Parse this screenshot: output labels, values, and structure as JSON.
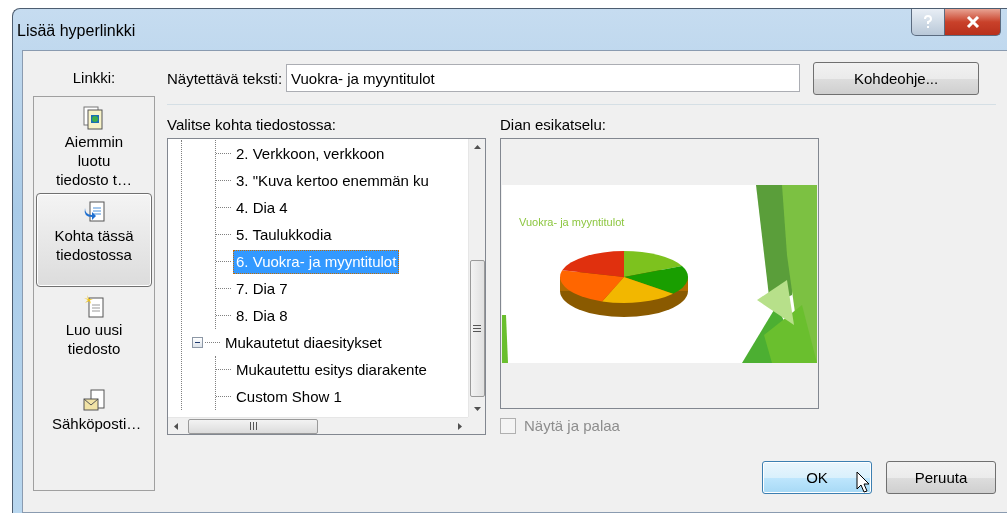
{
  "window": {
    "title": "Lisää hyperlinkki"
  },
  "link_to": {
    "label": "Linkki:",
    "items": [
      {
        "label": "Aiemmin luotu tiedosto t…",
        "selected": false
      },
      {
        "label": "Kohta tässä tiedostossa",
        "selected": true
      },
      {
        "label": "Luo uusi tiedosto",
        "selected": false
      },
      {
        "label": "Sähköposti…",
        "selected": false
      }
    ]
  },
  "display_text": {
    "label": "Näytettävä teksti:",
    "value": "Vuokra- ja myyntitulot"
  },
  "target_button": "Kohdeohje...",
  "place_tree": {
    "label": "Valitse kohta tiedostossa:",
    "items": [
      {
        "children": [
          {
            "label": "2. Verkkoon, verkkoon",
            "selected": false
          },
          {
            "label": "3. \"Kuva kertoo enemmän ku",
            "selected": false
          },
          {
            "label": "4. Dia 4",
            "selected": false
          },
          {
            "label": "5. Taulukkodia",
            "selected": false
          },
          {
            "label": "6. Vuokra- ja myyntitulot",
            "selected": true
          },
          {
            "label": "7. Dia 7",
            "selected": false
          },
          {
            "label": "8. Dia 8",
            "selected": false
          }
        ]
      },
      {
        "label": "Mukautetut diaesitykset",
        "selected": false,
        "expanded": true,
        "children": [
          {
            "label": "Mukautettu esitys diarakente",
            "selected": false
          },
          {
            "label": "Custom Show 1",
            "selected": false
          }
        ]
      }
    ]
  },
  "preview": {
    "label": "Dian esikatselu:",
    "slide_title": "Vuokra- ja myyntitulot"
  },
  "show_and_return": {
    "label": "Näytä ja palaa",
    "checked": false,
    "disabled": true
  },
  "buttons": [
    {
      "label": "OK",
      "default": true
    },
    {
      "label": "Peruuta",
      "default": false
    }
  ]
}
